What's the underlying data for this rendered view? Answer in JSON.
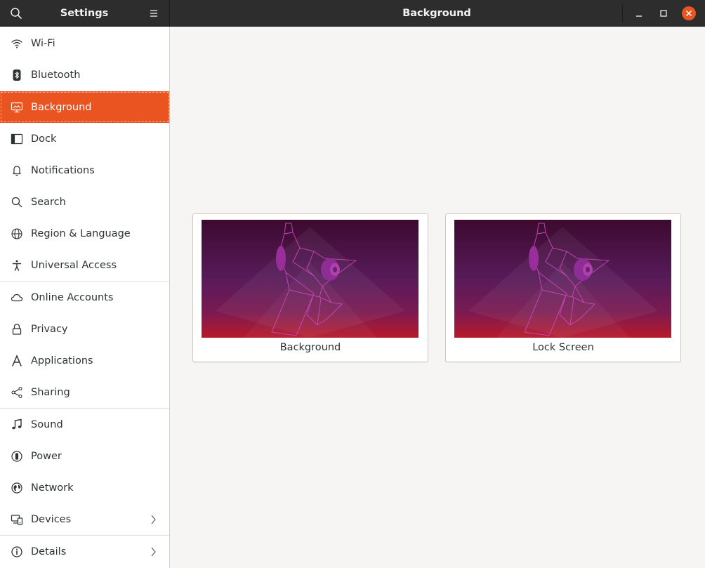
{
  "header": {
    "app_title": "Settings",
    "page_title": "Background"
  },
  "sidebar": {
    "items": [
      {
        "label": "Wi-Fi",
        "icon": "wifi-icon"
      },
      {
        "label": "Bluetooth",
        "icon": "bluetooth-icon"
      },
      {
        "label": "Background",
        "icon": "display-icon",
        "active": true
      },
      {
        "label": "Dock",
        "icon": "dock-icon"
      },
      {
        "label": "Notifications",
        "icon": "bell-icon"
      },
      {
        "label": "Search",
        "icon": "search-icon"
      },
      {
        "label": "Region & Language",
        "icon": "globe-icon"
      },
      {
        "label": "Universal Access",
        "icon": "accessibility-icon"
      },
      {
        "label": "Online Accounts",
        "icon": "cloud-icon"
      },
      {
        "label": "Privacy",
        "icon": "lock-icon"
      },
      {
        "label": "Applications",
        "icon": "applications-icon"
      },
      {
        "label": "Sharing",
        "icon": "share-icon"
      },
      {
        "label": "Sound",
        "icon": "music-note-icon"
      },
      {
        "label": "Power",
        "icon": "power-icon"
      },
      {
        "label": "Network",
        "icon": "network-icon"
      },
      {
        "label": "Devices",
        "icon": "devices-icon",
        "has_submenu": true
      },
      {
        "label": "Details",
        "icon": "info-icon",
        "has_submenu": true
      }
    ]
  },
  "main": {
    "cards": [
      {
        "caption": "Background"
      },
      {
        "caption": "Lock Screen"
      }
    ]
  },
  "colors": {
    "accent": "#e95420",
    "headerbar": "#2d2d2d",
    "close_button": "#e95420"
  }
}
